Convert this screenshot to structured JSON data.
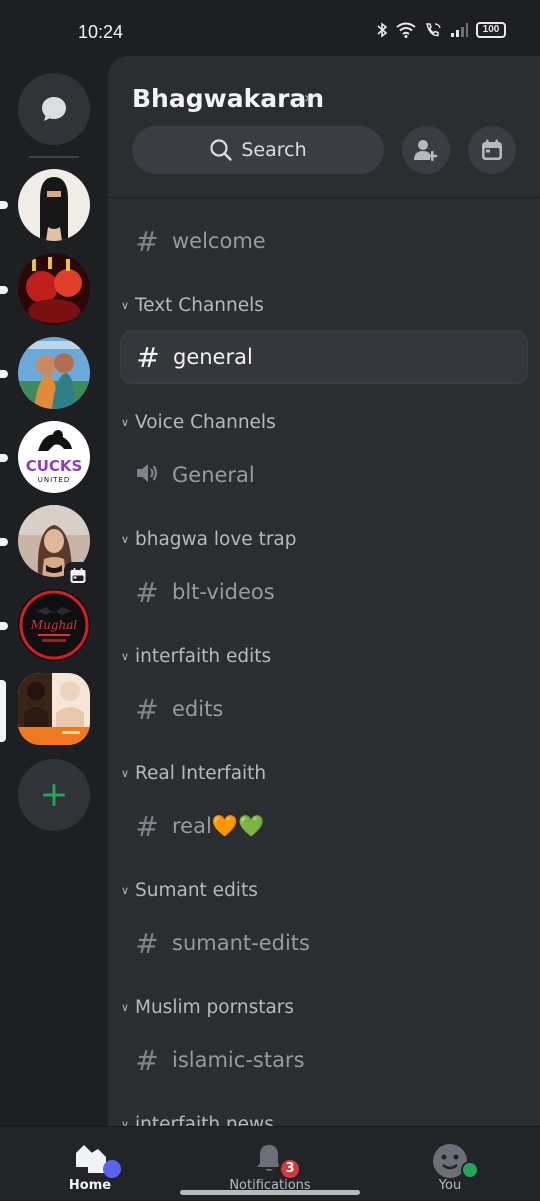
{
  "status": {
    "time": "10:24",
    "battery": "100"
  },
  "server": {
    "name": "Bhagwakaran"
  },
  "search": {
    "label": "Search"
  },
  "server_icons": [
    {
      "name": "server-avatar-1",
      "colors": [
        "#f4f1ea",
        "#1b1a1a"
      ]
    },
    {
      "name": "server-avatar-2",
      "colors": [
        "#2a0808",
        "#c0201a"
      ]
    },
    {
      "name": "server-avatar-3",
      "colors": [
        "#5f9fd1",
        "#e08a3a"
      ]
    },
    {
      "name": "server-avatar-4",
      "text": "CUCKS",
      "subtext": "UNITED"
    },
    {
      "name": "server-avatar-5",
      "colors": [
        "#c9b5a8",
        "#5a4036"
      ]
    },
    {
      "name": "server-avatar-6",
      "text": "Mughal",
      "colors": [
        "#0f0f12",
        "#d02020"
      ]
    },
    {
      "name": "server-avatar-7",
      "colors": [
        "#c58060",
        "#f07820"
      ]
    }
  ],
  "channels": {
    "welcome": "welcome",
    "cat_text": "Text Channels",
    "general": "general",
    "cat_voice": "Voice Channels",
    "voice_general": "General",
    "cat_blt": "bhagwa love trap",
    "blt": "blt-videos",
    "cat_interfaith": "interfaith edits",
    "edits": "edits",
    "cat_real": "Real Interfaith",
    "real": "real🧡💚",
    "cat_sumant": "Sumant edits",
    "sumant": "sumant-edits",
    "cat_muslim": "Muslim pornstars",
    "islamic": "islamic-stars",
    "cat_news": "interfaith news"
  },
  "nav": {
    "home": "Home",
    "notifications": "Notifications",
    "notifications_count": "3",
    "you": "You"
  }
}
